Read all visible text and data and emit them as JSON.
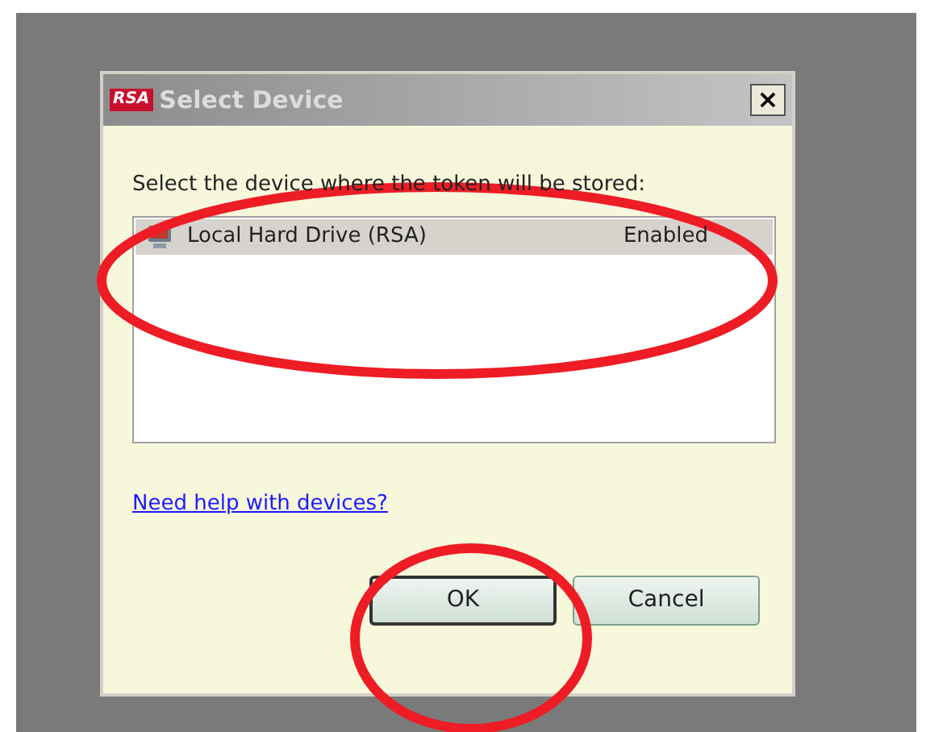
{
  "window": {
    "logo": "RSA",
    "title": "Select Device",
    "close": "×"
  },
  "prompt": "Select the device where the token will be stored:",
  "devices": [
    {
      "name": "Local Hard Drive (RSA)",
      "status": "Enabled",
      "selected": true
    }
  ],
  "help_link": "Need help with devices?",
  "buttons": [
    {
      "label": "OK",
      "default": true
    },
    {
      "label": "Cancel",
      "default": false
    }
  ],
  "annotations": [
    {
      "kind": "ellipse"
    },
    {
      "kind": "ellipse"
    }
  ]
}
